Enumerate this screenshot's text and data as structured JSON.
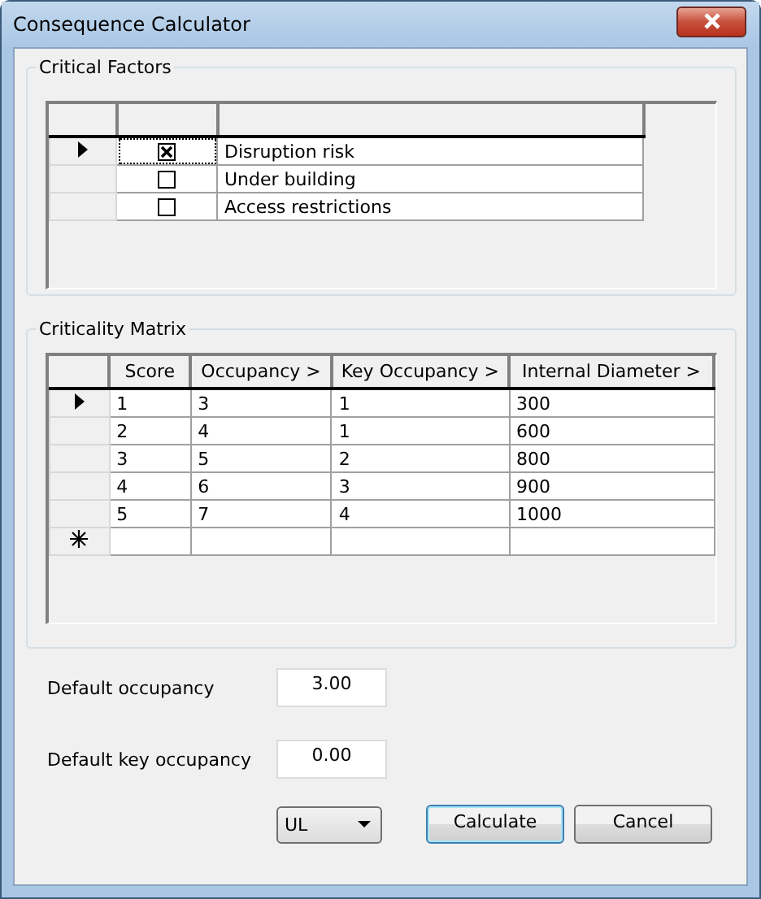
{
  "window": {
    "title": "Consequence Calculator"
  },
  "critical_factors": {
    "title": "Critical Factors",
    "rows": [
      {
        "label": "Disruption risk",
        "checked": true,
        "current": true
      },
      {
        "label": "Under building",
        "checked": false,
        "current": false
      },
      {
        "label": "Access restrictions",
        "checked": false,
        "current": false
      }
    ]
  },
  "criticality_matrix": {
    "title": "Criticality Matrix",
    "columns": [
      "Score",
      "Occupancy >",
      "Key Occupancy >",
      "Internal Diameter >"
    ],
    "rows": [
      {
        "cells": [
          "1",
          "3",
          "1",
          "300"
        ],
        "current": true
      },
      {
        "cells": [
          "2",
          "4",
          "1",
          "600"
        ],
        "current": false
      },
      {
        "cells": [
          "3",
          "5",
          "2",
          "800"
        ],
        "current": false
      },
      {
        "cells": [
          "4",
          "6",
          "3",
          "900"
        ],
        "current": false
      },
      {
        "cells": [
          "5",
          "7",
          "4",
          "1000"
        ],
        "current": false
      }
    ],
    "new_row": true
  },
  "fields": [
    {
      "label": "Default occupancy",
      "value": "3.00"
    },
    {
      "label": "Default key occupancy",
      "value": "0.00"
    }
  ],
  "dropdown": {
    "value": "UL"
  },
  "buttons": [
    {
      "label": "Calculate",
      "default": true
    },
    {
      "label": "Cancel",
      "default": false
    }
  ]
}
